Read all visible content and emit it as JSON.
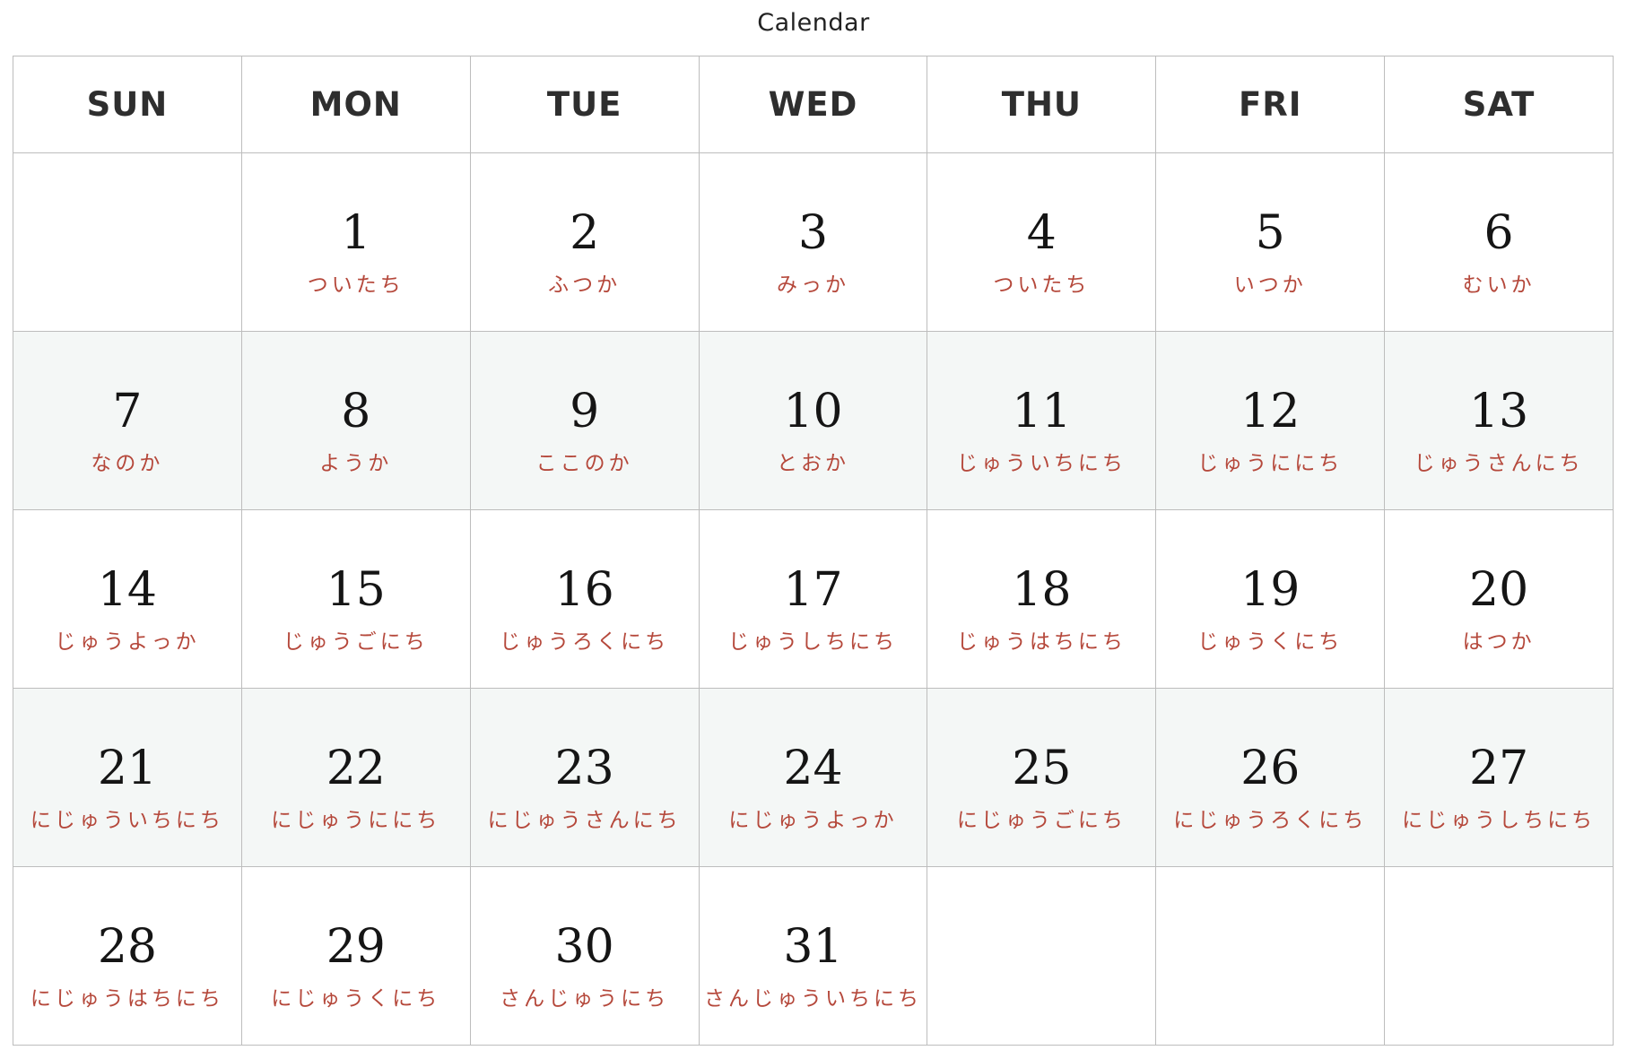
{
  "title": "Calendar",
  "colors": {
    "grid_line": "#bdbdbd",
    "shaded_row": "#f4f7f6",
    "reading_text": "#b5483b",
    "day_text": "#151515",
    "header_text": "#2e2e2e"
  },
  "weekdays": [
    "SUN",
    "MON",
    "TUE",
    "WED",
    "THU",
    "FRI",
    "SAT"
  ],
  "weeks": [
    [
      {
        "day": "",
        "reading": ""
      },
      {
        "day": "1",
        "reading": "ついたち"
      },
      {
        "day": "2",
        "reading": "ふつか"
      },
      {
        "day": "3",
        "reading": "みっか"
      },
      {
        "day": "4",
        "reading": "ついたち"
      },
      {
        "day": "5",
        "reading": "いつか"
      },
      {
        "day": "6",
        "reading": "むいか"
      }
    ],
    [
      {
        "day": "7",
        "reading": "なのか"
      },
      {
        "day": "8",
        "reading": "ようか"
      },
      {
        "day": "9",
        "reading": "ここのか"
      },
      {
        "day": "10",
        "reading": "とおか"
      },
      {
        "day": "11",
        "reading": "じゅういちにち"
      },
      {
        "day": "12",
        "reading": "じゅうににち"
      },
      {
        "day": "13",
        "reading": "じゅうさんにち"
      }
    ],
    [
      {
        "day": "14",
        "reading": "じゅうよっか"
      },
      {
        "day": "15",
        "reading": "じゅうごにち"
      },
      {
        "day": "16",
        "reading": "じゅうろくにち"
      },
      {
        "day": "17",
        "reading": "じゅうしちにち"
      },
      {
        "day": "18",
        "reading": "じゅうはちにち"
      },
      {
        "day": "19",
        "reading": "じゅうくにち"
      },
      {
        "day": "20",
        "reading": "はつか"
      }
    ],
    [
      {
        "day": "21",
        "reading": "にじゅういちにち"
      },
      {
        "day": "22",
        "reading": "にじゅうににち"
      },
      {
        "day": "23",
        "reading": "にじゅうさんにち"
      },
      {
        "day": "24",
        "reading": "にじゅうよっか"
      },
      {
        "day": "25",
        "reading": "にじゅうごにち"
      },
      {
        "day": "26",
        "reading": "にじゅうろくにち"
      },
      {
        "day": "27",
        "reading": "にじゅうしちにち"
      }
    ],
    [
      {
        "day": "28",
        "reading": "にじゅうはちにち"
      },
      {
        "day": "29",
        "reading": "にじゅうくにち"
      },
      {
        "day": "30",
        "reading": "さんじゅうにち"
      },
      {
        "day": "31",
        "reading": "さんじゅういちにち"
      },
      {
        "day": "",
        "reading": ""
      },
      {
        "day": "",
        "reading": ""
      },
      {
        "day": "",
        "reading": ""
      }
    ]
  ]
}
